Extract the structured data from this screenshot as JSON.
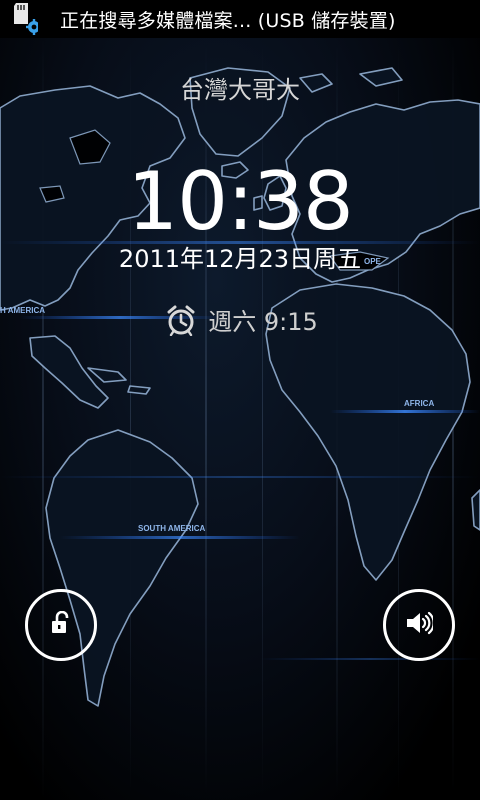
{
  "status_bar": {
    "notification_text": "正在搜尋多媒體檔案... (USB 儲存裝置)",
    "icon": "sd-card-scan-icon"
  },
  "lock_screen": {
    "carrier": "台灣大哥大",
    "time": "10:38",
    "date": "2011年12月23日周五",
    "next_alarm": "週六 9:15",
    "alarm_icon": "alarm-clock-icon"
  },
  "wallpaper": {
    "labels": {
      "europe": "OPE",
      "africa": "AFRICA",
      "south_america": "SOUTH AMERICA",
      "south_america_left": "H AMERICA"
    },
    "colors": {
      "map_outline": "#8aa6c8",
      "glow_blue": "#2f7cff"
    }
  },
  "controls": {
    "unlock_icon": "unlock-icon",
    "sound_icon": "speaker-icon"
  }
}
